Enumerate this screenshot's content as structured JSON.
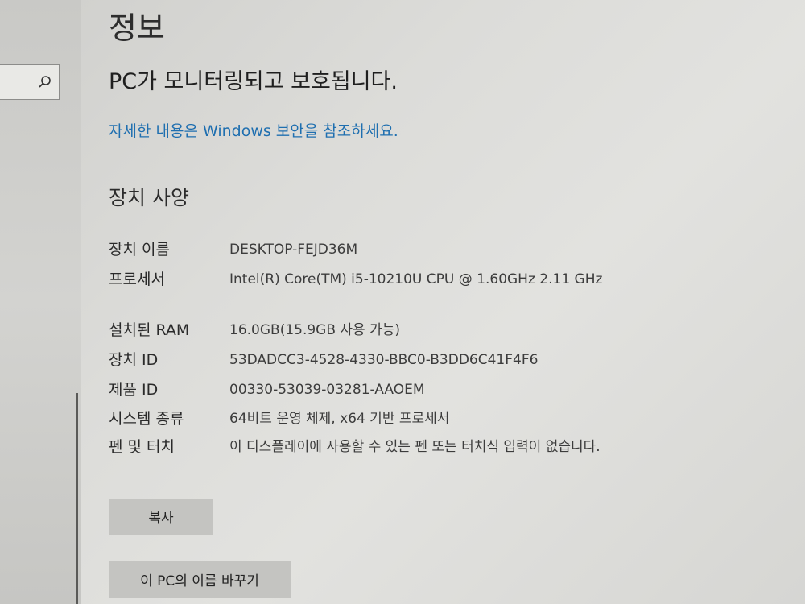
{
  "header": {
    "title": "정보"
  },
  "security": {
    "status": "PC가 모니터링되고 보호됩니다.",
    "link_text": "자세한 내용은 Windows 보안을 참조하세요."
  },
  "device_specs": {
    "section_title": "장치 사양",
    "rows": [
      {
        "label": "장치 이름",
        "value": "DESKTOP-FEJD36M"
      },
      {
        "label": "프로세서",
        "value": "Intel(R) Core(TM) i5-10210U CPU @ 1.60GHz   2.11 GHz"
      },
      {
        "label": "설치된 RAM",
        "value": "16.0GB(15.9GB 사용 가능)"
      },
      {
        "label": "장치 ID",
        "value": "53DADCC3-4528-4330-BBC0-B3DD6C41F4F6"
      },
      {
        "label": "제품 ID",
        "value": "00330-53039-03281-AAOEM"
      },
      {
        "label": "시스템 종류",
        "value": "64비트 운영 체제, x64 기반 프로세서"
      },
      {
        "label": "펜 및 터치",
        "value": "이 디스플레이에 사용할 수 있는 펜 또는 터치식 입력이 없습니다."
      }
    ]
  },
  "buttons": {
    "copy": "복사",
    "rename": "이 PC의 이름 바꾸기"
  },
  "icons": {
    "search": "search-icon"
  }
}
